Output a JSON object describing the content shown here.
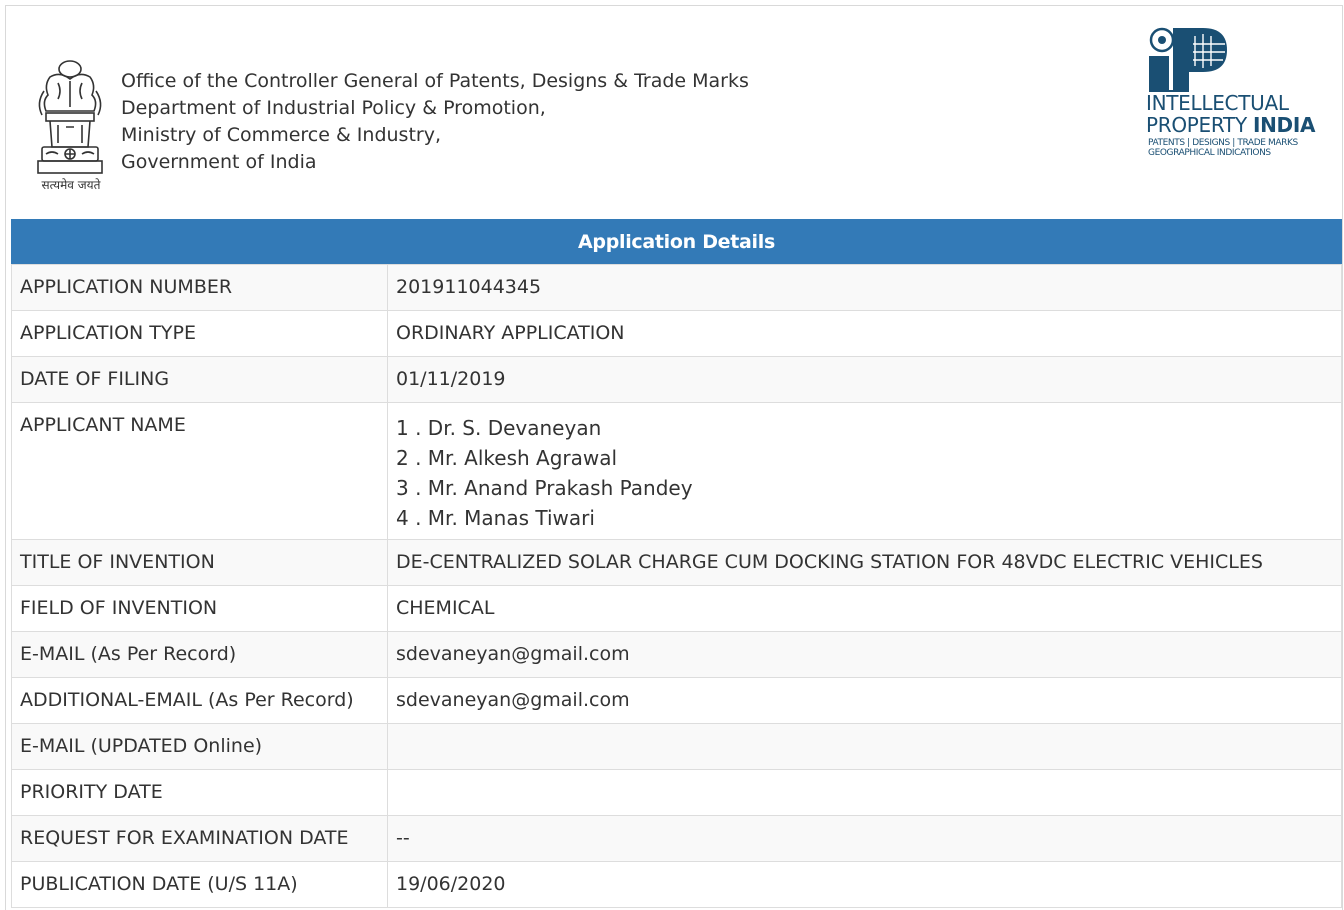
{
  "header": {
    "office_lines": [
      "Office of the Controller General of Patents, Designs & Trade Marks",
      "Department of Industrial Policy & Promotion,",
      "Ministry of Commerce & Industry,",
      "Government of India"
    ],
    "emblem_motto": "सत्यमेव जयते",
    "ipi_logo": {
      "line1": "INTELLECTUAL",
      "line2_prefix": "PROPERTY ",
      "line2_bold": "INDIA",
      "sub1": "PATENTS | DESIGNS | TRADE MARKS",
      "sub2": "GEOGRAPHICAL INDICATIONS"
    }
  },
  "details": {
    "title": "Application Details",
    "rows": [
      {
        "label": "APPLICATION NUMBER",
        "value": "201911044345"
      },
      {
        "label": "APPLICATION TYPE",
        "value": "ORDINARY APPLICATION"
      },
      {
        "label": "DATE OF FILING",
        "value": "01/11/2019"
      },
      {
        "label": "APPLICANT NAME",
        "value": ""
      },
      {
        "label": "TITLE OF INVENTION",
        "value": "DE-CENTRALIZED SOLAR CHARGE CUM DOCKING STATION FOR 48VDC ELECTRIC VEHICLES"
      },
      {
        "label": "FIELD OF INVENTION",
        "value": "CHEMICAL"
      },
      {
        "label": "E-MAIL (As Per Record)",
        "value": "sdevaneyan@gmail.com"
      },
      {
        "label": "ADDITIONAL-EMAIL (As Per Record)",
        "value": "sdevaneyan@gmail.com"
      },
      {
        "label": "E-MAIL (UPDATED Online)",
        "value": ""
      },
      {
        "label": "PRIORITY DATE",
        "value": ""
      },
      {
        "label": "REQUEST FOR EXAMINATION DATE",
        "value": "--"
      },
      {
        "label": "PUBLICATION DATE (U/S 11A)",
        "value": "19/06/2020"
      }
    ],
    "applicants": [
      "1 . Dr. S. Devaneyan",
      "2 . Mr. Alkesh Agrawal",
      "3 . Mr. Anand Prakash Pandey",
      "4 . Mr. Manas Tiwari"
    ]
  }
}
